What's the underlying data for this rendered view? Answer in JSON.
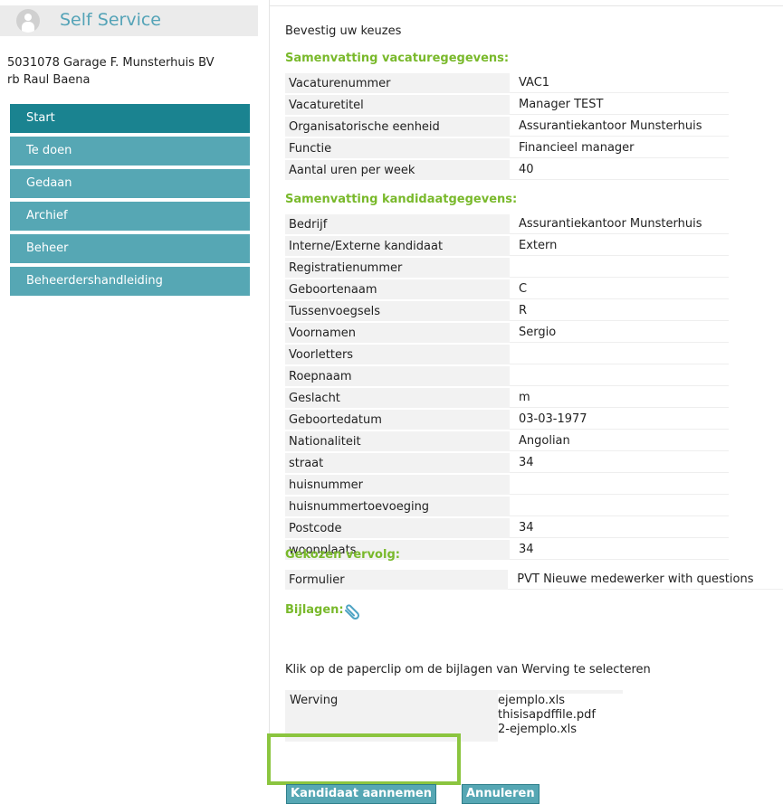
{
  "brand": {
    "title": "Self Service"
  },
  "company": {
    "line1": "5031078 Garage F. Munsterhuis BV",
    "line2": "rb Raul Baena"
  },
  "nav": [
    {
      "label": "Start",
      "active": true
    },
    {
      "label": "Te doen"
    },
    {
      "label": "Gedaan"
    },
    {
      "label": "Archief"
    },
    {
      "label": "Beheer"
    },
    {
      "label": "Beheerdershandleiding"
    }
  ],
  "main": {
    "confirm_title": "Bevestig uw keuzes",
    "vacature_title": "Samenvatting vacaturegegevens:",
    "vacature": [
      {
        "label": "Vacaturenummer",
        "value": "VAC1"
      },
      {
        "label": "Vacaturetitel",
        "value": "Manager TEST"
      },
      {
        "label": "Organisatorische eenheid",
        "value": "Assurantiekantoor Munsterhuis"
      },
      {
        "label": "Functie",
        "value": "Financieel manager"
      },
      {
        "label": "Aantal uren per week",
        "value": "40"
      }
    ],
    "kandidaat_title": "Samenvatting kandidaatgegevens:",
    "kandidaat": [
      {
        "label": "Bedrijf",
        "value": "Assurantiekantoor Munsterhuis"
      },
      {
        "label": "Interne/Externe kandidaat",
        "value": "Extern"
      },
      {
        "label": "Registratienummer",
        "value": ""
      },
      {
        "label": "Geboortenaam",
        "value": "C"
      },
      {
        "label": "Tussenvoegsels",
        "value": "R"
      },
      {
        "label": "Voornamen",
        "value": "Sergio"
      },
      {
        "label": "Voorletters",
        "value": ""
      },
      {
        "label": "Roepnaam",
        "value": ""
      },
      {
        "label": "Geslacht",
        "value": "m"
      },
      {
        "label": "Geboortedatum",
        "value": "03-03-1977"
      },
      {
        "label": "Nationaliteit",
        "value": "Angolian"
      },
      {
        "label": "straat",
        "value": "34"
      },
      {
        "label": "huisnummer",
        "value": ""
      },
      {
        "label": "huisnummertoevoeging",
        "value": ""
      },
      {
        "label": "Postcode",
        "value": "34"
      },
      {
        "label": "woonplaats",
        "value": "34"
      }
    ],
    "vervolg_title": "Gekozen vervolg:",
    "vervolg": [
      {
        "label": "Formulier",
        "value": "PVT Nieuwe medewerker with questions"
      }
    ],
    "bijlagen_title": "Bijlagen:",
    "bijlagen_text": "Klik op de paperclip om de bijlagen van Werving te selecteren",
    "werving_label": "Werving",
    "werving_files": [
      "ejemplo.xls",
      "thisisapdffile.pdf",
      "2-ejemplo.xls"
    ]
  },
  "buttons": {
    "accept": "Kandidaat aannemen",
    "cancel": "Annuleren"
  },
  "colors": {
    "accent": "#56a7b4",
    "nav_active": "#1a8390",
    "section": "#79b92b",
    "highlight": "#8bc53f"
  },
  "icons": {
    "brand": "user-icon",
    "attach": "paperclip-icon"
  }
}
